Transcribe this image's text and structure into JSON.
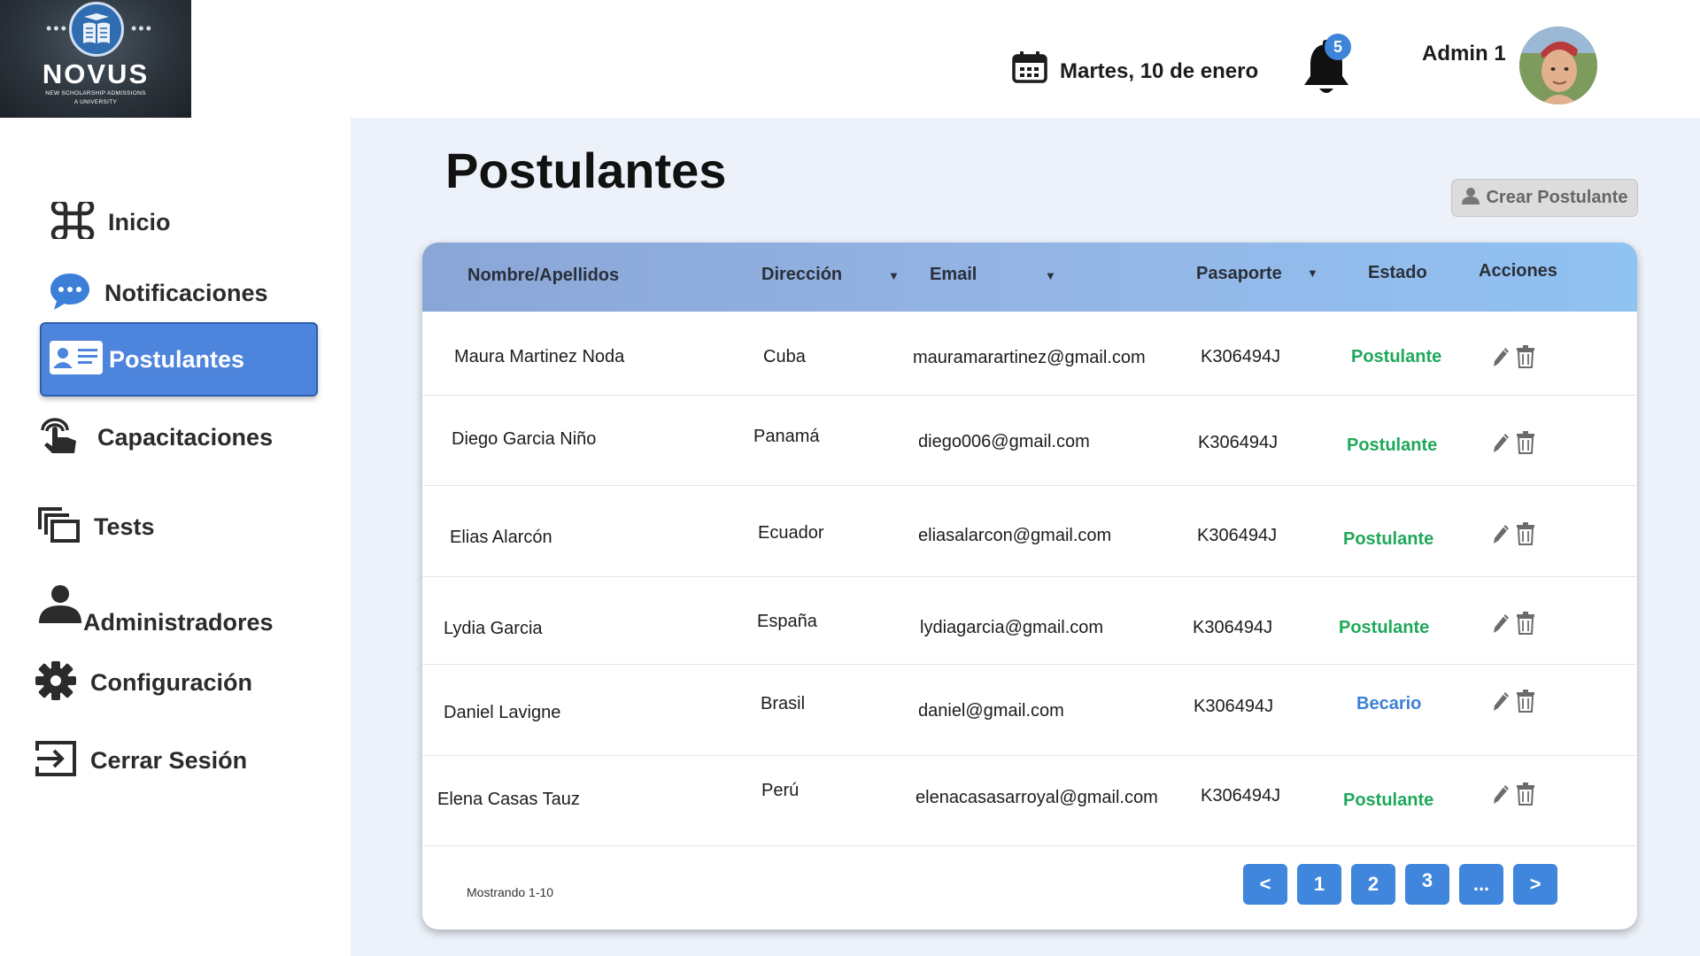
{
  "logo": {
    "brand": "NOVUS",
    "tagline_1": "NEW SCHOLARSHIP ADMISSIONS",
    "tagline_2": "A UNIVERSITY"
  },
  "header": {
    "date": "Martes, 10 de enero",
    "notifications_count": "5",
    "user_name": "Admin 1"
  },
  "sidebar": {
    "items": [
      {
        "label": "Inicio",
        "icon": "command-icon"
      },
      {
        "label": "Notificaciones",
        "icon": "chat-bubble-icon"
      },
      {
        "label": "Postulantes",
        "icon": "id-card-icon",
        "active": true
      },
      {
        "label": "Capacitaciones",
        "icon": "touch-icon"
      },
      {
        "label": "Tests",
        "icon": "stacked-windows-icon"
      },
      {
        "label": "Administradores",
        "icon": "person-icon"
      },
      {
        "label": "Configuración",
        "icon": "gear-icon"
      },
      {
        "label": "Cerrar Sesión",
        "icon": "logout-icon"
      }
    ]
  },
  "main": {
    "title": "Postulantes",
    "create_button": "Crear Postulante",
    "columns": [
      "Nombre/Apellidos",
      "Dirección",
      "Email",
      "Pasaporte",
      "Estado",
      "Acciones"
    ],
    "rows": [
      {
        "name": "Maura Martinez Noda",
        "country": "Cuba",
        "email": "mauramarartinez@gmail.com",
        "passport": "K306494J",
        "status": "Postulante"
      },
      {
        "name": "Diego Garcia Niño",
        "country": "Panamá",
        "email": "diego006@gmail.com",
        "passport": "K306494J",
        "status": "Postulante"
      },
      {
        "name": "Elias Alarcón",
        "country": "Ecuador",
        "email": "eliasalarcon@gmail.com",
        "passport": "K306494J",
        "status": "Postulante"
      },
      {
        "name": "Lydia Garcia",
        "country": "España",
        "email": "lydiagarcia@gmail.com",
        "passport": "K306494J",
        "status": "Postulante"
      },
      {
        "name": "Daniel Lavigne",
        "country": "Brasil",
        "email": "daniel@gmail.com",
        "passport": "K306494J",
        "status": "Becario"
      },
      {
        "name": "Elena Casas Tauz",
        "country": "Perú",
        "email": "elenacasasarroyal@gmail.com",
        "passport": "K306494J",
        "status": "Postulante"
      }
    ],
    "showing": "Mostrando 1-10",
    "pagination": [
      "<",
      "1",
      "2",
      "3",
      "...",
      ">"
    ]
  },
  "colors": {
    "accent": "#4d84dc",
    "status_postulante": "#1fa85a",
    "status_becario": "#3d80d6"
  }
}
